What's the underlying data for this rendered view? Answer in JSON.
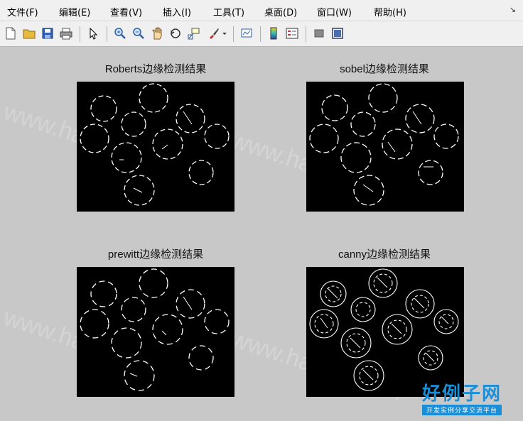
{
  "menu": [
    {
      "label": "文件(F)"
    },
    {
      "label": "编辑(E)"
    },
    {
      "label": "查看(V)"
    },
    {
      "label": "插入(I)"
    },
    {
      "label": "工具(T)"
    },
    {
      "label": "桌面(D)"
    },
    {
      "label": "窗口(W)"
    },
    {
      "label": "帮助(H)"
    }
  ],
  "toolbar": {
    "icons": [
      "new-figure-icon",
      "open-file-icon",
      "save-icon",
      "print-icon",
      "pointer-icon",
      "zoom-in-icon",
      "zoom-out-icon",
      "pan-hand-icon",
      "rotate-3d-icon",
      "data-cursor-icon",
      "brush-icon",
      "link-plot-icon",
      "colorbar-icon",
      "legend-icon",
      "hide-plot-tools-icon",
      "show-plot-tools-icon"
    ]
  },
  "plots": [
    {
      "title": "Roberts边缘检测结果"
    },
    {
      "title": "sobel边缘检测结果"
    },
    {
      "title": "prewitt边缘检测结果"
    },
    {
      "title": "canny边缘检测结果"
    }
  ],
  "watermark": "www.haolizi.com",
  "logo": {
    "main": "好例子网",
    "sub": "开发实例分享交流平台"
  },
  "colors": {
    "figure_bg": "#c8c8c8",
    "axes_bg": "#000000",
    "edge": "#ffffff",
    "logo": "#1a8fd8"
  }
}
